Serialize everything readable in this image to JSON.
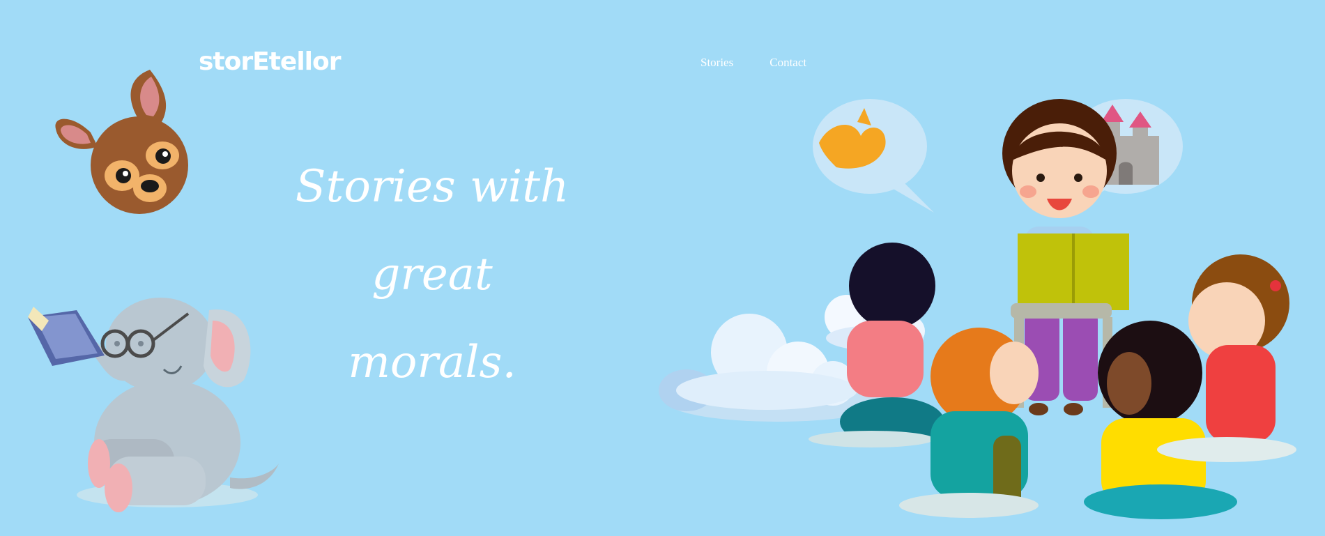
{
  "header": {
    "brand": "storEtellor",
    "nav": [
      {
        "label": "Stories"
      },
      {
        "label": "Contact"
      }
    ]
  },
  "hero": {
    "headline_line1": "Stories with great",
    "headline_line2": "morals."
  },
  "illustrations": {
    "deer": "deer-head-illustration",
    "elephant": "elephant-reading-illustration",
    "storytime": "teacher-reading-to-children-illustration"
  },
  "colors": {
    "background": "#a1dbf7",
    "text": "#ffffff",
    "deer_brown": "#9a5a2e",
    "elephant_gray": "#b9c7d1",
    "book_green": "#c0c20a"
  }
}
